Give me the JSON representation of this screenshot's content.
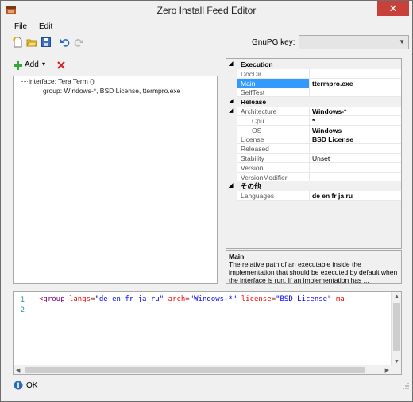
{
  "window": {
    "title": "Zero Install Feed Editor",
    "close_glyph": "✕"
  },
  "menu": {
    "file": "File",
    "edit": "Edit"
  },
  "toolbar": {
    "icons": [
      "new-file-icon",
      "open-folder-icon",
      "save-icon",
      "undo-icon",
      "redo-icon"
    ],
    "gnupg_label": "GnuPG key:",
    "gnupg_value": ""
  },
  "tree_toolbar": {
    "add_label": "Add",
    "add_arrow": "▾"
  },
  "tree": {
    "nodes": [
      {
        "label": "interface: Tera Term ()"
      },
      {
        "label": "group: Windows-*, BSD License, ttermpro.exe"
      }
    ]
  },
  "properties": {
    "rows": [
      {
        "type": "category",
        "label": "Execution"
      },
      {
        "type": "prop",
        "name": "DocDir",
        "value": ""
      },
      {
        "type": "prop",
        "name": "Main",
        "value": "ttermpro.exe",
        "selected": true
      },
      {
        "type": "prop",
        "name": "SelfTest",
        "value": ""
      },
      {
        "type": "category",
        "label": "Release"
      },
      {
        "type": "prop",
        "name": "Architecture",
        "value": "Windows-*",
        "expanded": true
      },
      {
        "type": "sub",
        "name": "Cpu",
        "value": "*"
      },
      {
        "type": "sub",
        "name": "OS",
        "value": "Windows"
      },
      {
        "type": "prop",
        "name": "License",
        "value": "BSD License"
      },
      {
        "type": "prop",
        "name": "Released",
        "value": ""
      },
      {
        "type": "prop",
        "name": "Stability",
        "value": "Unset",
        "plain": true
      },
      {
        "type": "prop",
        "name": "Version",
        "value": ""
      },
      {
        "type": "prop",
        "name": "VersionModifier",
        "value": ""
      },
      {
        "type": "category",
        "label": "その他"
      },
      {
        "type": "prop",
        "name": "Languages",
        "value": "de en fr ja ru"
      }
    ]
  },
  "description": {
    "title": "Main",
    "text": "The relative path of an executable inside the implementation that should be executed by default when the interface is run. If an implementation has ..."
  },
  "code": {
    "line_numbers": [
      "1",
      "2"
    ],
    "tokens": [
      {
        "kind": "tag",
        "text": "<"
      },
      {
        "kind": "kw",
        "text": "group"
      },
      {
        "kind": "plain",
        "text": " "
      },
      {
        "kind": "attr",
        "text": "langs"
      },
      {
        "kind": "tag",
        "text": "="
      },
      {
        "kind": "str",
        "text": "\"de en fr ja ru\""
      },
      {
        "kind": "plain",
        "text": " "
      },
      {
        "kind": "attr",
        "text": "arch"
      },
      {
        "kind": "tag",
        "text": "="
      },
      {
        "kind": "str",
        "text": "\"Windows-*\""
      },
      {
        "kind": "plain",
        "text": " "
      },
      {
        "kind": "attr",
        "text": "license"
      },
      {
        "kind": "tag",
        "text": "="
      },
      {
        "kind": "str",
        "text": "\"BSD License\""
      },
      {
        "kind": "plain",
        "text": " "
      },
      {
        "kind": "attr",
        "text": "ma"
      }
    ]
  },
  "status": {
    "icon": "info-icon",
    "text": "OK"
  }
}
